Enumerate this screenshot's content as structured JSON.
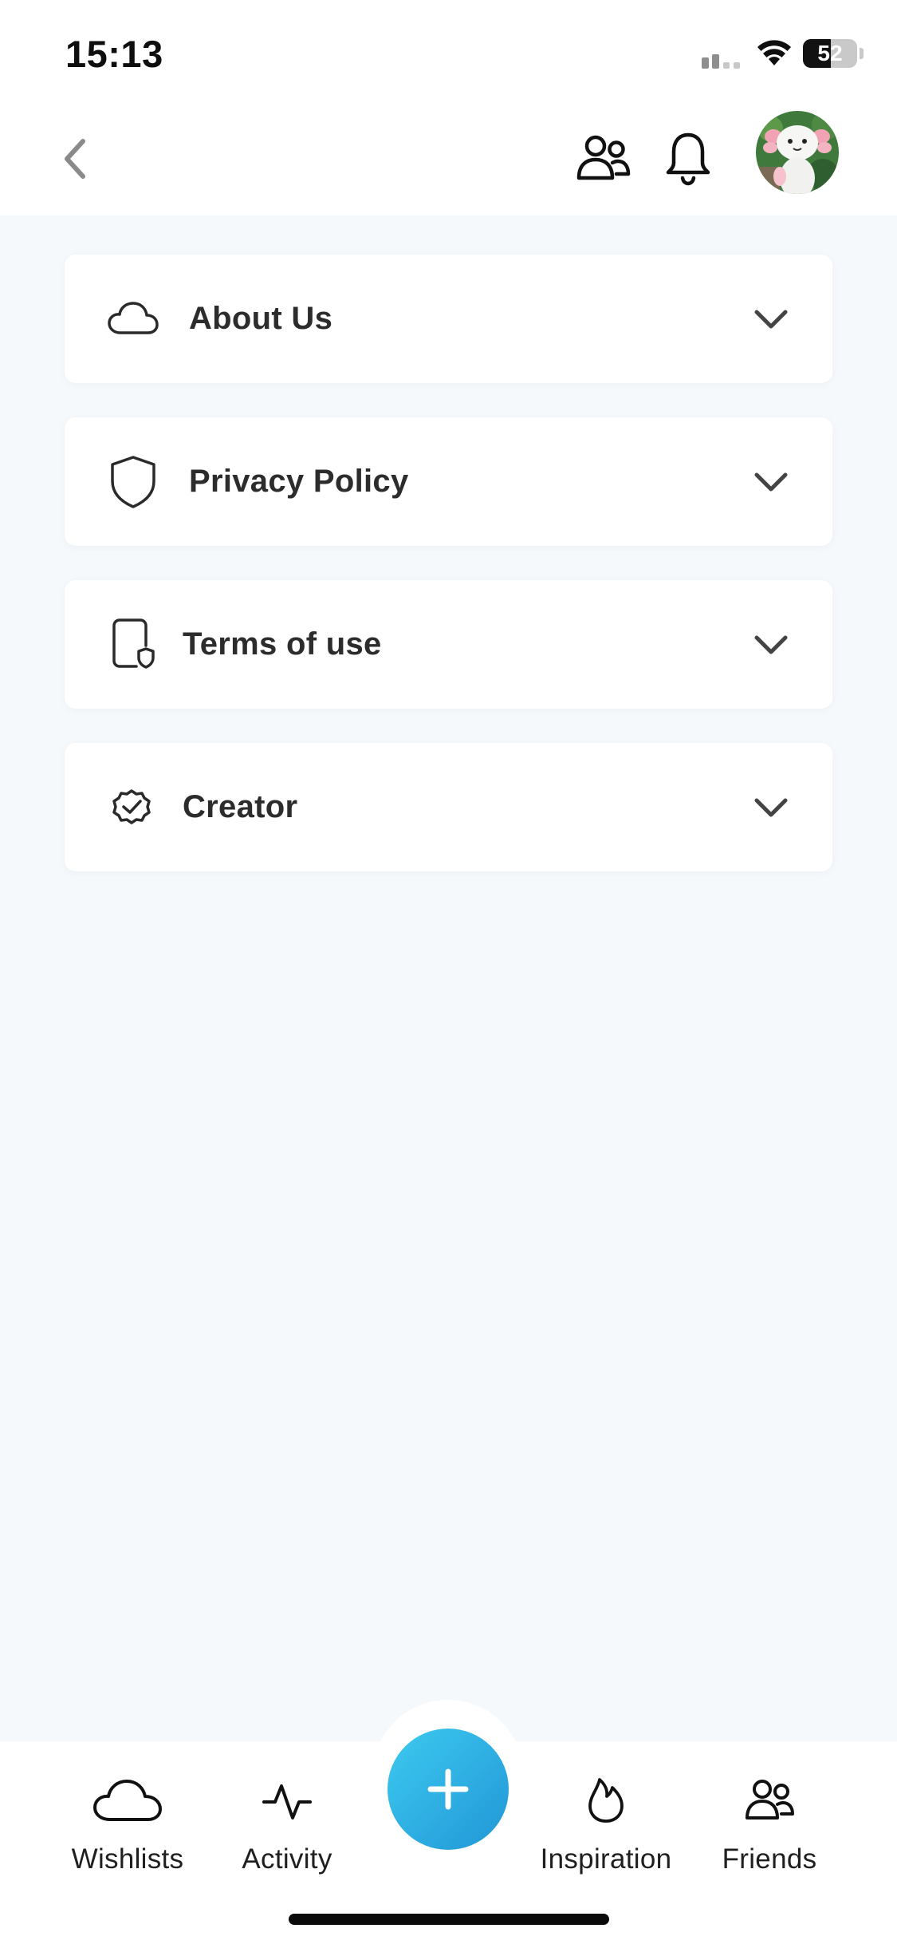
{
  "status_bar": {
    "time": "15:13",
    "battery_level": "52",
    "battery_fraction": 0.52
  },
  "header": {
    "back_icon": "chevron-left-icon",
    "friends_icon": "friends-icon",
    "notifications_icon": "bell-icon",
    "avatar_icon": "avatar"
  },
  "sections": [
    {
      "label": "About Us",
      "icon": "cloud-icon",
      "expanded": false
    },
    {
      "label": "Privacy Policy",
      "icon": "shield-icon",
      "expanded": false
    },
    {
      "label": "Terms of use",
      "icon": "document-shield-icon",
      "expanded": false
    },
    {
      "label": "Creator",
      "icon": "verified-badge-icon",
      "expanded": false
    }
  ],
  "tab_bar": {
    "tabs": [
      {
        "label": "Wishlists",
        "icon": "cloud-icon"
      },
      {
        "label": "Activity",
        "icon": "activity-icon"
      },
      {
        "label": "Inspiration",
        "icon": "flame-icon"
      },
      {
        "label": "Friends",
        "icon": "friends-icon"
      }
    ],
    "add_icon": "plus-icon"
  },
  "colors": {
    "accent_start": "#3dcaf0",
    "accent_end": "#2196d6",
    "background": "#f6f9fc",
    "card": "#ffffff",
    "text": "#2c2c2c"
  }
}
